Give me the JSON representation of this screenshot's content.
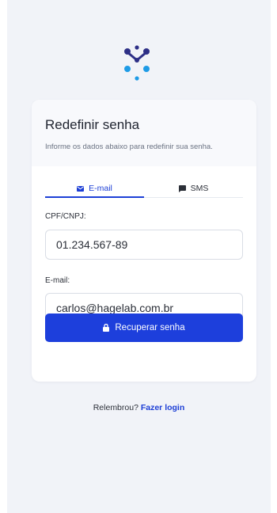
{
  "brand": {
    "logo_icon": "molecule-logo-icon",
    "logo_colors": [
      "#2d2f86",
      "#1e9be6"
    ]
  },
  "card": {
    "title": "Redefinir senha",
    "subtitle": "Informe os dados abaixo para redefinir sua senha."
  },
  "tabs": [
    {
      "label": "E-mail",
      "icon": "envelope-icon",
      "active": true
    },
    {
      "label": "SMS",
      "icon": "chat-bubble-icon",
      "active": false
    }
  ],
  "form": {
    "cpf": {
      "label": "CPF/CNPJ:",
      "value": "01.234.567-89"
    },
    "email": {
      "label": "E-mail:",
      "value": "carlos@hagelab.com.br"
    },
    "submit": {
      "label": "Recuperar senha",
      "icon": "lock-icon"
    }
  },
  "footer": {
    "text": "Relembrou?",
    "link": "Fazer login"
  },
  "colors": {
    "accent": "#1d3fdc",
    "background": "#f1f3f8",
    "card": "#ffffff"
  }
}
